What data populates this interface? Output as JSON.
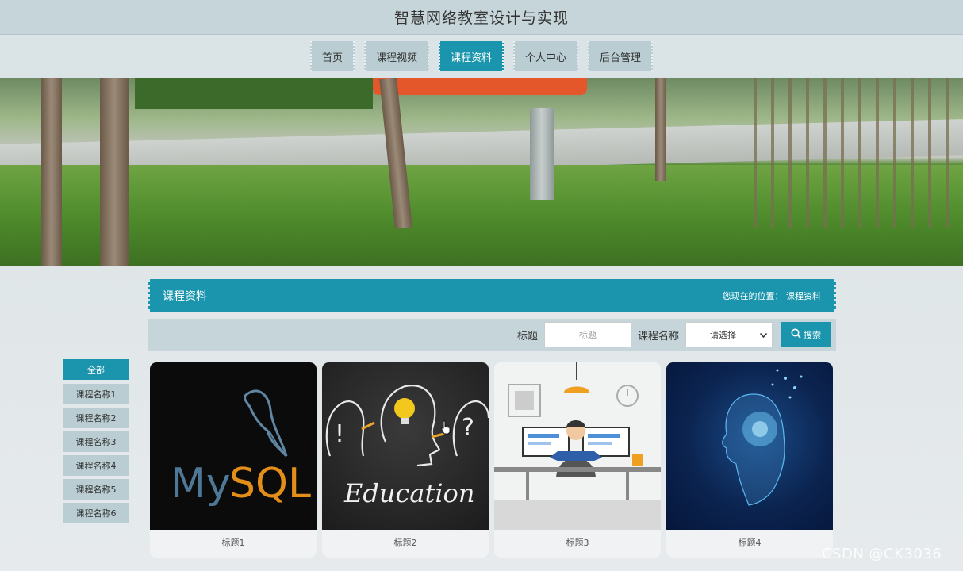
{
  "header": {
    "title": "智慧网络教室设计与实现"
  },
  "nav": {
    "items": [
      {
        "label": "首页"
      },
      {
        "label": "课程视频"
      },
      {
        "label": "课程资料",
        "active": true
      },
      {
        "label": "个人中心"
      },
      {
        "label": "后台管理"
      }
    ]
  },
  "section": {
    "title": "课程资料",
    "breadcrumb": "您现在的位置：  课程资料"
  },
  "search": {
    "title_label": "标题",
    "title_placeholder": "标题",
    "course_label": "课程名称",
    "course_selected": "请选择",
    "button_label": "搜索"
  },
  "sidebar": {
    "items": [
      {
        "label": "全部",
        "active": true
      },
      {
        "label": "课程名称1"
      },
      {
        "label": "课程名称2"
      },
      {
        "label": "课程名称3"
      },
      {
        "label": "课程名称4"
      },
      {
        "label": "课程名称5"
      },
      {
        "label": "课程名称6"
      }
    ]
  },
  "cards": [
    {
      "title": "标题1",
      "image_label": "MySQL"
    },
    {
      "title": "标题2",
      "image_label": "Education"
    },
    {
      "title": "标题3"
    },
    {
      "title": "标题4"
    }
  ],
  "watermark": "CSDN @CK3036",
  "colors": {
    "accent": "#1a95ad",
    "nav_bg": "#b9cdd2",
    "header_bg": "#c5d5d9"
  }
}
